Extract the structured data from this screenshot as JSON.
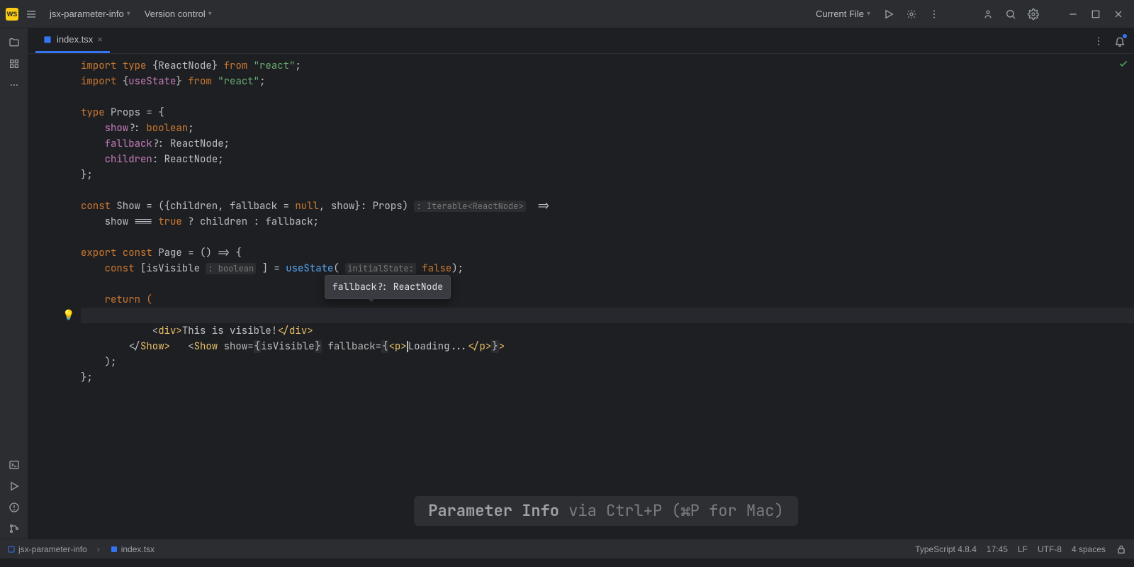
{
  "titlebar": {
    "project_name": "jsx-parameter-info",
    "vcs_label": "Version control",
    "config_label": "Current File"
  },
  "tab": {
    "filename": "index.tsx"
  },
  "popup": {
    "text": "fallback?: ReactNode"
  },
  "overlay": {
    "bold": "Parameter Info",
    "rest": " via Ctrl+P (⌘P for Mac)"
  },
  "code": {
    "l1_a": "import",
    "l1_b": "type",
    "l1_c": "{ReactNode}",
    "l1_d": "from",
    "l1_e": "\"react\"",
    "l1_f": ";",
    "l2_a": "import",
    "l2_b": "{",
    "l2_c": "useState",
    "l2_d": "}",
    "l2_e": "from",
    "l2_f": "\"react\"",
    "l2_g": ";",
    "l4_a": "type",
    "l4_b": "Props",
    "l4_c": " = {",
    "l5_a": "    show",
    "l5_b": "?: ",
    "l5_c": "boolean",
    "l5_d": ";",
    "l6_a": "    fallback",
    "l6_b": "?: ",
    "l6_c": "ReactNode",
    "l6_d": ";",
    "l7_a": "    children",
    "l7_b": ": ",
    "l7_c": "ReactNode",
    "l7_d": ";",
    "l8": "};",
    "l10_a": "const",
    "l10_b": " Show ",
    "l10_c": "= ({children, fallback = ",
    "l10_d": "null",
    "l10_e": ", show}: ",
    "l10_f": "Props",
    "l10_g": ") ",
    "l10_h": ": Iterable<ReactNode>",
    "l10_i": "  =>",
    "l11_a": "    show === ",
    "l11_b": "true",
    "l11_c": " ? children : fallback;",
    "l13_a": "export ",
    "l13_b": "const ",
    "l13_c": "Page ",
    "l13_d": "= () => {",
    "l14_a": "    const ",
    "l14_b": "[isVisible ",
    "l14_c": ": boolean",
    "l14_d": " ] = ",
    "l14_e": "useState",
    "l14_f": "( ",
    "l14_g": "initialState:",
    "l14_h": " false",
    "l14_i": ");",
    "l16": "    return (",
    "l17_a": "        <",
    "l17_b": "Show",
    "l17_c": " show",
    "l17_d": "=",
    "l17_e": "{",
    "l17_f": "isVisible",
    "l17_g": "}",
    "l17_h": " fallback",
    "l17_i": "=",
    "l17_j": "{",
    "l17_k": "<",
    "l17_l": "p",
    "l17_m": ">",
    "l17_n": "Loading...",
    "l17_o": "</",
    "l17_p": "p",
    "l17_q": ">",
    "l17_r": "}",
    "l17_s": ">",
    "l18_a": "            <",
    "l18_b": "div",
    "l18_c": ">",
    "l18_d": "This is visible!",
    "l18_e": "</",
    "l18_f": "div",
    "l18_g": ">",
    "l19_a": "        </",
    "l19_b": "Show",
    "l19_c": ">",
    "l20": "    );",
    "l21": "};"
  },
  "status": {
    "project": "jsx-parameter-info",
    "file": "index.tsx",
    "ts": "TypeScript 4.8.4",
    "time": "17:45",
    "lf": "LF",
    "enc": "UTF-8",
    "indent": "4 spaces"
  }
}
